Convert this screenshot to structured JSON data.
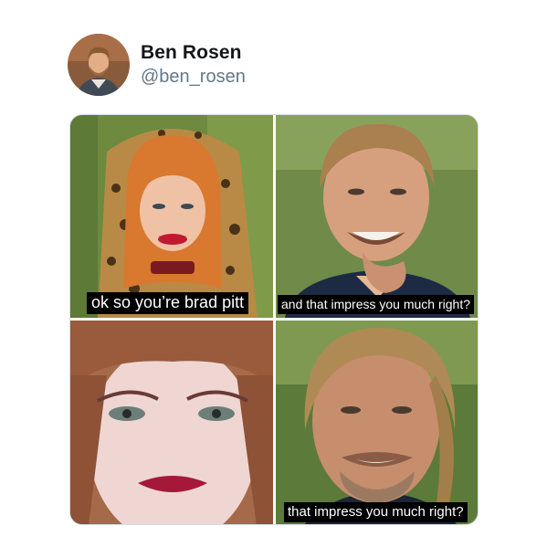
{
  "user": {
    "display_name": "Ben Rosen",
    "handle": "@ben_rosen"
  },
  "meme": {
    "panels": [
      {
        "caption": "ok so you’re brad pitt"
      },
      {
        "caption": "and that impress you much right?"
      },
      {
        "caption": ""
      },
      {
        "caption": "that impress you much right?"
      }
    ]
  },
  "colors": {
    "name_text": "#14171a",
    "handle_text": "#657786",
    "caption_bg": "#000000",
    "caption_text": "#ffffff"
  }
}
